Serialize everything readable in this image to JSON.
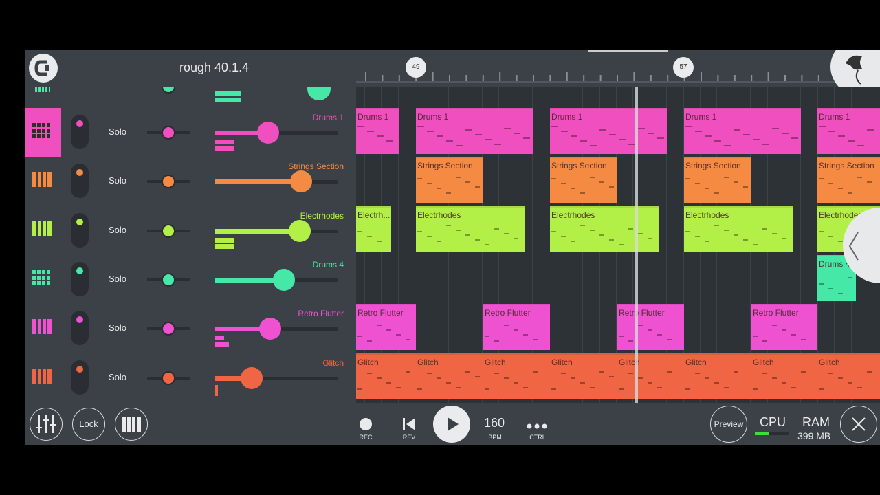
{
  "header": {
    "title": "rough 40.1.4"
  },
  "timeline": {
    "markers": [
      "49",
      "57"
    ]
  },
  "channels": [
    {
      "name": "Drums 1",
      "color": "#f04fc0",
      "solo": "Solo",
      "volume": 0.43,
      "selected": true
    },
    {
      "name": "Strings Section",
      "color": "#f58a43",
      "solo": "Solo",
      "volume": 0.7
    },
    {
      "name": "Electrhodes",
      "color": "#b2f047",
      "solo": "Solo",
      "volume": 0.69
    },
    {
      "name": "Drums 4",
      "color": "#46e8a8",
      "solo": "Solo",
      "volume": 0.56
    },
    {
      "name": "Retro Flutter",
      "color": "#ef52d1",
      "solo": "Solo",
      "volume": 0.45
    },
    {
      "name": "Glitch",
      "color": "#f06644",
      "solo": "Solo",
      "volume": 0.3
    }
  ],
  "clips": [
    [
      "Drums 1",
      "Drums 1",
      "Drums 1",
      "Drums 1",
      "Drums 1"
    ],
    [
      "Strings Section",
      "Strings Section",
      "Strings Section",
      "Strings Section"
    ],
    [
      "Electrh...",
      "Electrhodes",
      "Electrhodes",
      "Electrhodes",
      "Electrhodes"
    ],
    [
      "Drums 4"
    ],
    [
      "Retro Flutter",
      "Retro Flutter",
      "Retro Flutter",
      "Retro Flutter"
    ],
    [
      "Glitch",
      "Glitch",
      "Glitch",
      "Glitch",
      "Glitch",
      "Glitch",
      "Glitch",
      "Glitch"
    ]
  ],
  "bottom_bar": {
    "lock": "Lock",
    "rec": "REC",
    "rev": "REV",
    "tempo": "160",
    "bpm": "BPM",
    "ctrl": "CTRL",
    "preview": "Preview",
    "cpu": "CPU",
    "ram": "RAM",
    "ram_value": "399 MB"
  }
}
